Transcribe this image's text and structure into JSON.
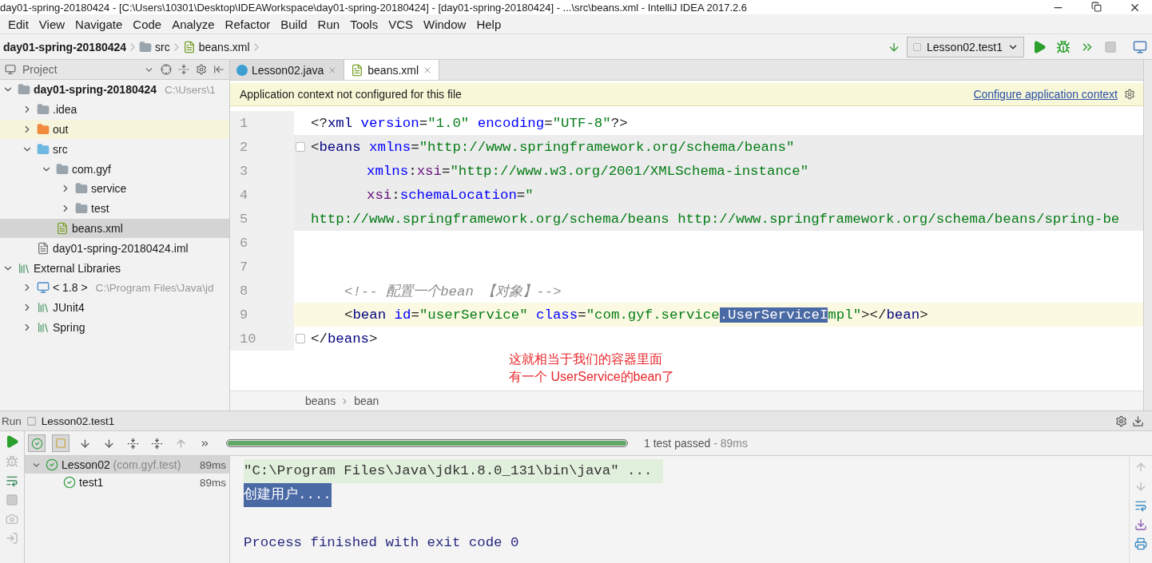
{
  "window": {
    "title": "day01-spring-20180424 - [C:\\Users\\10301\\Desktop\\IDEAWorkspace\\day01-spring-20180424] - [day01-spring-20180424] - ...\\src\\beans.xml - IntelliJ IDEA 2017.2.6"
  },
  "menu": [
    "Edit",
    "View",
    "Navigate",
    "Code",
    "Analyze",
    "Refactor",
    "Build",
    "Run",
    "Tools",
    "VCS",
    "Window",
    "Help"
  ],
  "navigation": {
    "crumbs": [
      {
        "label": "day01-spring-20180424",
        "kind": "module"
      },
      {
        "label": "src",
        "kind": "folder"
      },
      {
        "label": "beans.xml",
        "kind": "xml"
      }
    ],
    "run_config": "Lesson02.test1"
  },
  "project": {
    "title": "Project",
    "tree": [
      {
        "label": "day01-spring-20180424",
        "hint": "C:\\Users\\1",
        "kind": "module",
        "expanded": true,
        "selected": false,
        "highlighted": false,
        "children": [
          {
            "label": ".idea",
            "kind": "folder",
            "expanded": false,
            "selected": false,
            "highlighted": false
          },
          {
            "label": "out",
            "kind": "excluded-folder",
            "expanded": false,
            "selected": false,
            "highlighted": true
          },
          {
            "label": "src",
            "kind": "source-folder",
            "expanded": true,
            "selected": false,
            "highlighted": false,
            "children": [
              {
                "label": "com.gyf",
                "kind": "package",
                "expanded": true,
                "selected": false,
                "highlighted": false,
                "children": [
                  {
                    "label": "service",
                    "kind": "package",
                    "expanded": false,
                    "selected": false,
                    "highlighted": false
                  },
                  {
                    "label": "test",
                    "kind": "package",
                    "expanded": false,
                    "selected": false,
                    "highlighted": false
                  }
                ]
              },
              {
                "label": "beans.xml",
                "kind": "xml",
                "selected": true,
                "highlighted": false
              }
            ]
          },
          {
            "label": "day01-spring-20180424.iml",
            "kind": "file",
            "selected": false,
            "highlighted": false
          }
        ]
      },
      {
        "label": "External Libraries",
        "kind": "libraries",
        "expanded": true,
        "selected": false,
        "highlighted": false,
        "children": [
          {
            "label": "< 1.8 >",
            "hint": "C:\\Program Files\\Java\\jd",
            "kind": "jdk",
            "expanded": false,
            "selected": false,
            "highlighted": false
          },
          {
            "label": "JUnit4",
            "kind": "library",
            "expanded": false,
            "selected": false,
            "highlighted": false
          },
          {
            "label": "Spring",
            "kind": "library",
            "expanded": false,
            "selected": false,
            "highlighted": false
          }
        ]
      }
    ]
  },
  "editor": {
    "tabs": [
      {
        "label": "Lesson02.java",
        "kind": "java",
        "selected": false
      },
      {
        "label": "beans.xml",
        "kind": "xml",
        "selected": true
      }
    ],
    "notification": {
      "message": "Application context not configured for this file",
      "link": "Configure application context"
    },
    "lines": [
      {
        "number": "1",
        "kind": "top",
        "block": false,
        "caret_line": false,
        "tokens": [
          {
            "kind": "punct",
            "text": "<?"
          },
          {
            "kind": "tag",
            "text": "xml"
          },
          {
            "kind": "attr",
            "text": " version"
          },
          {
            "kind": "punct",
            "text": "="
          },
          {
            "kind": "value",
            "text": "\"1.0\""
          },
          {
            "kind": "attr",
            "text": " encoding"
          },
          {
            "kind": "punct",
            "text": "="
          },
          {
            "kind": "value",
            "text": "\"UTF-8\""
          },
          {
            "kind": "punct",
            "text": "?>"
          }
        ]
      },
      {
        "number": "2",
        "kind": "top",
        "block": true,
        "caret_line": false,
        "fold": true,
        "tokens": [
          {
            "kind": "punct",
            "text": "<"
          },
          {
            "kind": "tag",
            "text": "beans"
          },
          {
            "kind": "attr",
            "text": " xmlns"
          },
          {
            "kind": "punct",
            "text": "="
          },
          {
            "kind": "value",
            "text": "\"http://www.springframework.org/schema/beans\""
          }
        ]
      },
      {
        "number": "3",
        "kind": "attribute",
        "block": true,
        "caret_line": false,
        "tokens": [
          {
            "kind": "attr",
            "text": "xmlns"
          },
          {
            "kind": "punct",
            "text": ":"
          },
          {
            "kind": "ns",
            "text": "xsi"
          },
          {
            "kind": "punct",
            "text": "="
          },
          {
            "kind": "value",
            "text": "\"http://www.w3.org/2001/XMLSchema-instance\""
          }
        ]
      },
      {
        "number": "4",
        "kind": "attribute",
        "block": true,
        "caret_line": false,
        "tokens": [
          {
            "kind": "ns",
            "text": "xsi"
          },
          {
            "kind": "punct",
            "text": ":"
          },
          {
            "kind": "attr",
            "text": "schemaLocation"
          },
          {
            "kind": "punct",
            "text": "="
          },
          {
            "kind": "value",
            "text": "\""
          }
        ]
      },
      {
        "number": "5",
        "kind": "top",
        "block": true,
        "caret_line": false,
        "tokens": [
          {
            "kind": "value",
            "text": "http://www.springframework.org/schema/beans http://www.springframework.org/schema/beans/spring-be"
          }
        ]
      },
      {
        "number": "6",
        "block": false,
        "caret_line": false
      },
      {
        "number": "7",
        "block": false,
        "caret_line": false
      },
      {
        "number": "8",
        "kind": "child",
        "block": false,
        "caret_line": false,
        "tokens": [
          {
            "kind": "comment",
            "text": "<!-- 配置一个bean 【对象】-->"
          }
        ]
      },
      {
        "number": "9",
        "kind": "child",
        "block": false,
        "caret_line": true,
        "tokens": [
          {
            "kind": "punct",
            "text": "<"
          },
          {
            "kind": "tag",
            "text": "bean"
          },
          {
            "kind": "attr",
            "text": " id"
          },
          {
            "kind": "punct",
            "text": "="
          },
          {
            "kind": "value",
            "text": "\"userService\""
          },
          {
            "kind": "attr",
            "text": " class"
          },
          {
            "kind": "punct",
            "text": "="
          },
          {
            "kind": "value",
            "text": "\"com.gyf.service"
          },
          {
            "kind": "selection",
            "text": ".UserServiceI"
          },
          {
            "kind": "value",
            "text": "mpl\""
          },
          {
            "kind": "punct",
            "text": "></"
          },
          {
            "kind": "tag",
            "text": "bean"
          },
          {
            "kind": "punct",
            "text": ">"
          }
        ]
      },
      {
        "number": "10",
        "kind": "top",
        "block": false,
        "caret_line": false,
        "fold": true,
        "tokens": [
          {
            "kind": "punct",
            "text": "</"
          },
          {
            "kind": "tag",
            "text": "beans"
          },
          {
            "kind": "punct",
            "text": ">"
          }
        ]
      }
    ],
    "annotation": [
      "这就相当于我们的容器里面",
      "有一个 UserService的bean了"
    ],
    "breadcrumbs": [
      "beans",
      "bean"
    ]
  },
  "run": {
    "title": "Run",
    "config": "Lesson02.test1",
    "progress": {
      "level": 1.0
    },
    "status": "1 test passed",
    "duration": " - 89ms",
    "tests": [
      {
        "label": "Lesson02",
        "detail": "(com.gyf.test)",
        "time": "89ms",
        "passed": true,
        "selected": true,
        "expanded": true,
        "children": [
          {
            "label": "test1",
            "time": "89ms",
            "passed": true,
            "selected": false
          }
        ]
      }
    ],
    "console": [
      {
        "kind": "command",
        "text": "\"C:\\Program Files\\Java\\jdk1.8.0_131\\bin\\java\" ...",
        "selected": false
      },
      {
        "kind": "output",
        "text": "创建用户....",
        "selected": true
      },
      {
        "kind": "exit",
        "text": "Process finished with exit code 0",
        "selected": false
      }
    ]
  }
}
